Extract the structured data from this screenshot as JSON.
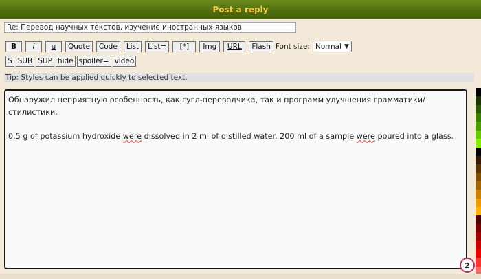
{
  "header": {
    "title": "Post a reply"
  },
  "subject": {
    "value": "Re: Перевод научных текстов, изучение иностранных языков"
  },
  "toolbar": {
    "row1": [
      "B",
      "i",
      "u",
      "Quote",
      "Code",
      "List",
      "List=",
      "[*]",
      "Img",
      "URL",
      "Flash"
    ],
    "font_size_label": "Font size:",
    "font_size_value": "Normal",
    "row2": [
      "S",
      "SUB",
      "SUP",
      "hide",
      "spoiler=",
      "video"
    ]
  },
  "tip": "Tip: Styles can be applied quickly to selected text.",
  "editor": {
    "para1": "Обнаружил неприятную особенность, как гугл-переводчика, так и программ улучшения грамматики/стилистики.",
    "para2_parts": [
      "0.5 g of potassium hydroxide ",
      "were",
      " dissolved in 2 ml of distilled water. 200 ml of a sample ",
      "were",
      " poured into a glass."
    ]
  },
  "badge": "2",
  "colors": {
    "header_bg": "#567515",
    "header_text": "#f5c84a",
    "palette": [
      "#000000",
      "#1a3300",
      "#2a5a00",
      "#3b7d00",
      "#4aa000",
      "#66cc00",
      "#88ee00",
      "#000000",
      "#331a00",
      "#5a3300",
      "#7d4d00",
      "#a06600",
      "#cc8000",
      "#ee9900",
      "#ffb300",
      "#4d0000",
      "#7d0000",
      "#a00000",
      "#cc0000",
      "#ee0000",
      "#ff3333",
      "#ff6666"
    ]
  }
}
